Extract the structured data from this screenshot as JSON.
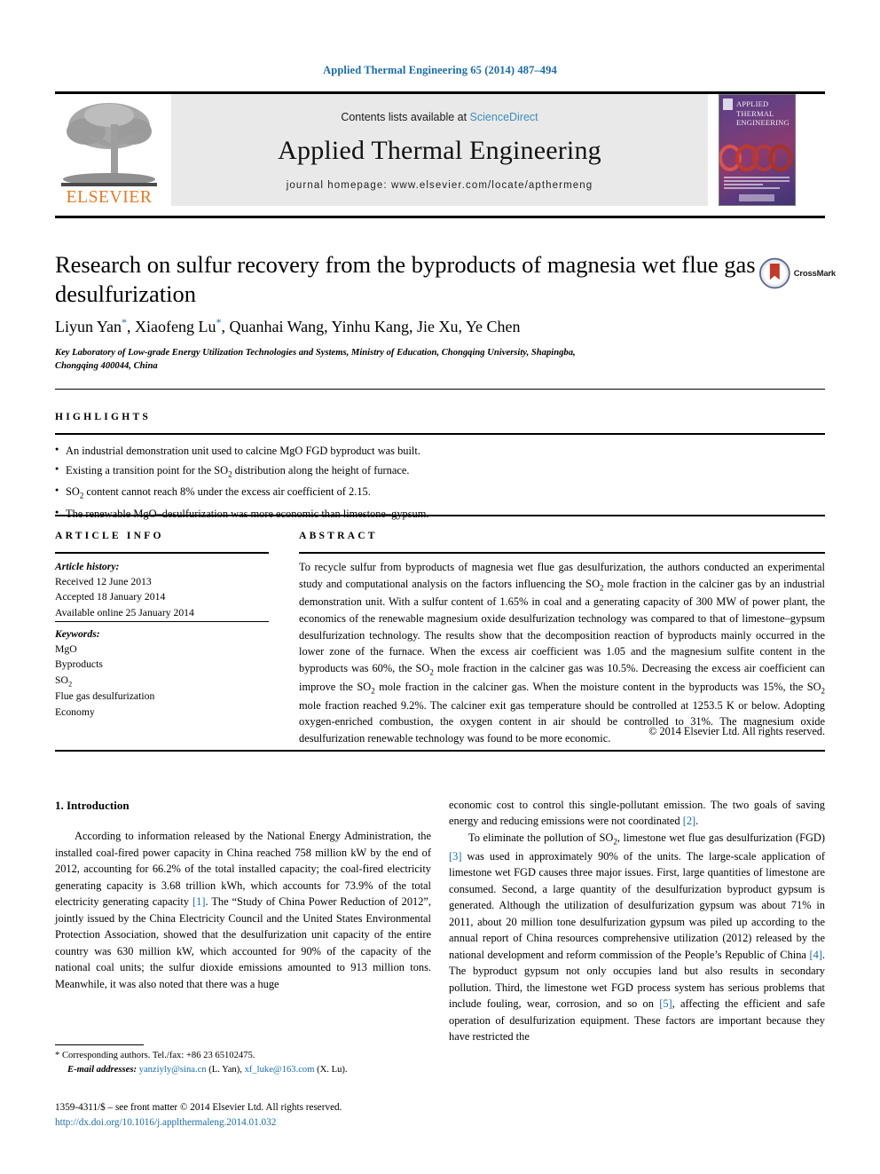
{
  "running_head": "Applied Thermal Engineering 65 (2014) 487–494",
  "header": {
    "contents_prefix": "Contents lists available at ",
    "sciencedirect": "ScienceDirect",
    "journal_title": "Applied Thermal Engineering",
    "homepage": "journal homepage: www.elsevier.com/locate/apthermeng",
    "publisher_logo_word": "ELSEVIER",
    "cover_title_line1": "APPLIED",
    "cover_title_line2": "THERMAL",
    "cover_title_line3": "ENGINEERING"
  },
  "article": {
    "title": "Research on sulfur recovery from the byproducts of magnesia wet flue gas desulfurization",
    "crossmark_label": "CrossMark",
    "authors_html": "Liyun Yan<sup>*</sup>, Xiaofeng Lu<sup>*</sup>, Quanhai Wang, Yinhu Kang, Jie Xu, Ye Chen",
    "authors_plain": "Liyun Yan*, Xiaofeng Lu*, Quanhai Wang, Yinhu Kang, Jie Xu, Ye Chen",
    "affiliation": "Key Laboratory of Low-grade Energy Utilization Technologies and Systems, Ministry of Education, Chongqing University, Shapingba, Chongqing 400044, China"
  },
  "highlights": {
    "label": "HIGHLIGHTS",
    "items_html": [
      "An industrial demonstration unit used to calcine MgO FGD byproduct was built.",
      "Existing a transition point for the SO<sub>2</sub> distribution along the height of furnace.",
      "SO<sub>2</sub> content cannot reach 8% under the excess air coefficient of 2.15.",
      "The renewable MgO–desulfurization was more economic than limestone–gypsum."
    ]
  },
  "article_info": {
    "label": "ARTICLE INFO",
    "history_title": "Article history:",
    "history": [
      "Received 12 June 2013",
      "Accepted 18 January 2014",
      "Available online 25 January 2014"
    ],
    "keywords_title": "Keywords:",
    "keywords_html": [
      "MgO",
      "Byproducts",
      "SO<sub>2</sub>",
      "Flue gas desulfurization",
      "Economy"
    ]
  },
  "abstract": {
    "label": "ABSTRACT",
    "text_html": "To recycle sulfur from byproducts of magnesia wet flue gas desulfurization, the authors conducted an experimental study and computational analysis on the factors influencing the SO<sub>2</sub> mole fraction in the calciner gas by an industrial demonstration unit. With a sulfur content of 1.65% in coal and a generating capacity of 300 MW of power plant, the economics of the renewable magnesium oxide desulfurization technology was compared to that of limestone–gypsum desulfurization technology. The results show that the decomposition reaction of byproducts mainly occurred in the lower zone of the furnace. When the excess air coefficient was 1.05 and the magnesium sulfite content in the byproducts was 60%, the SO<sub>2</sub> mole fraction in the calciner gas was 10.5%. Decreasing the excess air coefficient can improve the SO<sub>2</sub> mole fraction in the calciner gas. When the moisture content in the byproducts was 15%, the SO<sub>2</sub> mole fraction reached 9.2%. The calciner exit gas temperature should be controlled at 1253.5 K or below. Adopting oxygen-enriched combustion, the oxygen content in air should be controlled to 31%. The magnesium oxide desulfurization renewable technology was found to be more economic.",
    "copyright": "© 2014 Elsevier Ltd. All rights reserved."
  },
  "body": {
    "section_number_title": "1. Introduction",
    "left_paragraph_1_html": "According to information released by the National Energy Administration, the installed coal-fired power capacity in China reached 758 million kW by the end of 2012, accounting for 66.2% of the total installed capacity; the coal-fired electricity generating capacity is 3.68 trillion kWh, which accounts for 73.9% of the total electricity generating capacity <span class=\"ref\">[1]</span>. The “Study of China Power Reduction of 2012”, jointly issued by the China Electricity Council and the United States Environmental Protection Association, showed that the desulfurization unit capacity of the entire country was 630 million kW, which accounted for 90% of the capacity of the national coal units; the sulfur dioxide emissions amounted to 913 million tons. Meanwhile, it was also noted that there was a huge",
    "right_paragraph_1_html": "economic cost to control this single-pollutant emission. The two goals of saving energy and reducing emissions were not coordinated <span class=\"ref\">[2]</span>.",
    "right_paragraph_2_html": "To eliminate the pollution of SO<sub>2</sub>, limestone wet flue gas desulfurization (FGD) <span class=\"ref\">[3]</span> was used in approximately 90% of the units. The large-scale application of limestone wet FGD causes three major issues. First, large quantities of limestone are consumed. Second, a large quantity of the desulfurization byproduct gypsum is generated. Although the utilization of desulfurization gypsum was about 71% in 2011, about 20 million tone desulfurization gypsum was piled up according to the annual report of China resources comprehensive utilization (2012) released by the national development and reform commission of the People’s Republic of China <span class=\"ref\">[4]</span>. The byproduct gypsum not only occupies land but also results in secondary pollution. Third, the limestone wet FGD process system has serious problems that include fouling, wear, corrosion, and so on <span class=\"ref\">[5]</span>, affecting the efficient and safe operation of desulfurization equipment. These factors are important because they have restricted the"
  },
  "footnotes": {
    "corresponding_html": "* Corresponding authors. Tel./fax: +86 23 65102475.",
    "email_html": "<span class=\"ital\">E-mail addresses:</span> <span class=\"issn-doi\">yanziyly@sina.cn</span> (L. Yan), <span class=\"issn-doi\">xf_luke@163.com</span> (X. Lu).",
    "issn_html": "1359-4311/$ – see front matter © 2014 Elsevier Ltd. All rights reserved.",
    "doi": "http://dx.doi.org/10.1016/j.applthermaleng.2014.01.032"
  },
  "colors": {
    "link_blue": "#1b6ca8",
    "sciencedirect_blue": "#3c8dbc",
    "elsevier_orange": "#E87722"
  }
}
